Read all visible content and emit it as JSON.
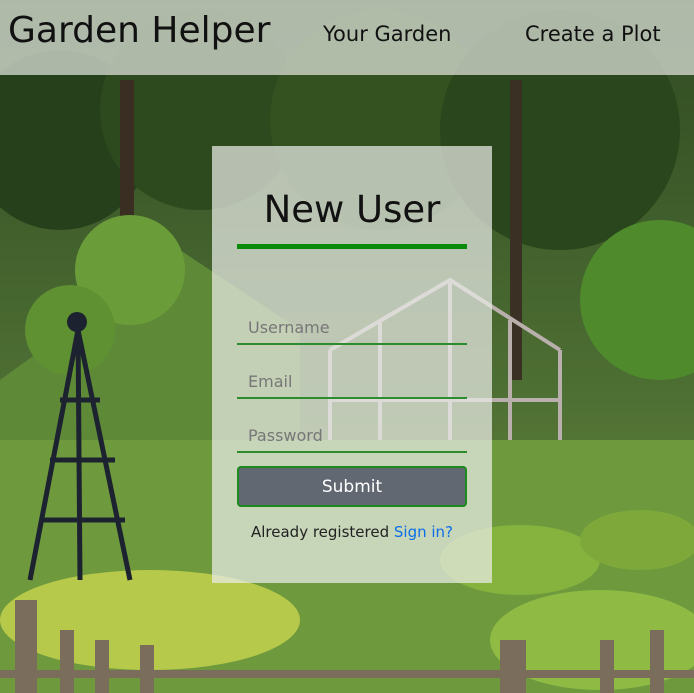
{
  "header": {
    "brand": "Garden Helper",
    "nav": {
      "your_garden": "Your Garden",
      "create_plot": "Create a Plot"
    }
  },
  "form": {
    "title": "New User",
    "username_placeholder": "Username",
    "email_placeholder": "Email",
    "password_placeholder": "Password",
    "submit_label": "Submit",
    "already_text": "Already registered",
    "signin_link": "Sign in?"
  },
  "colors": {
    "accent_green": "#0a8a0a",
    "submit_bg": "#626872",
    "link_blue": "#0a6fe8"
  },
  "background": {
    "icon": "garden-photo"
  }
}
